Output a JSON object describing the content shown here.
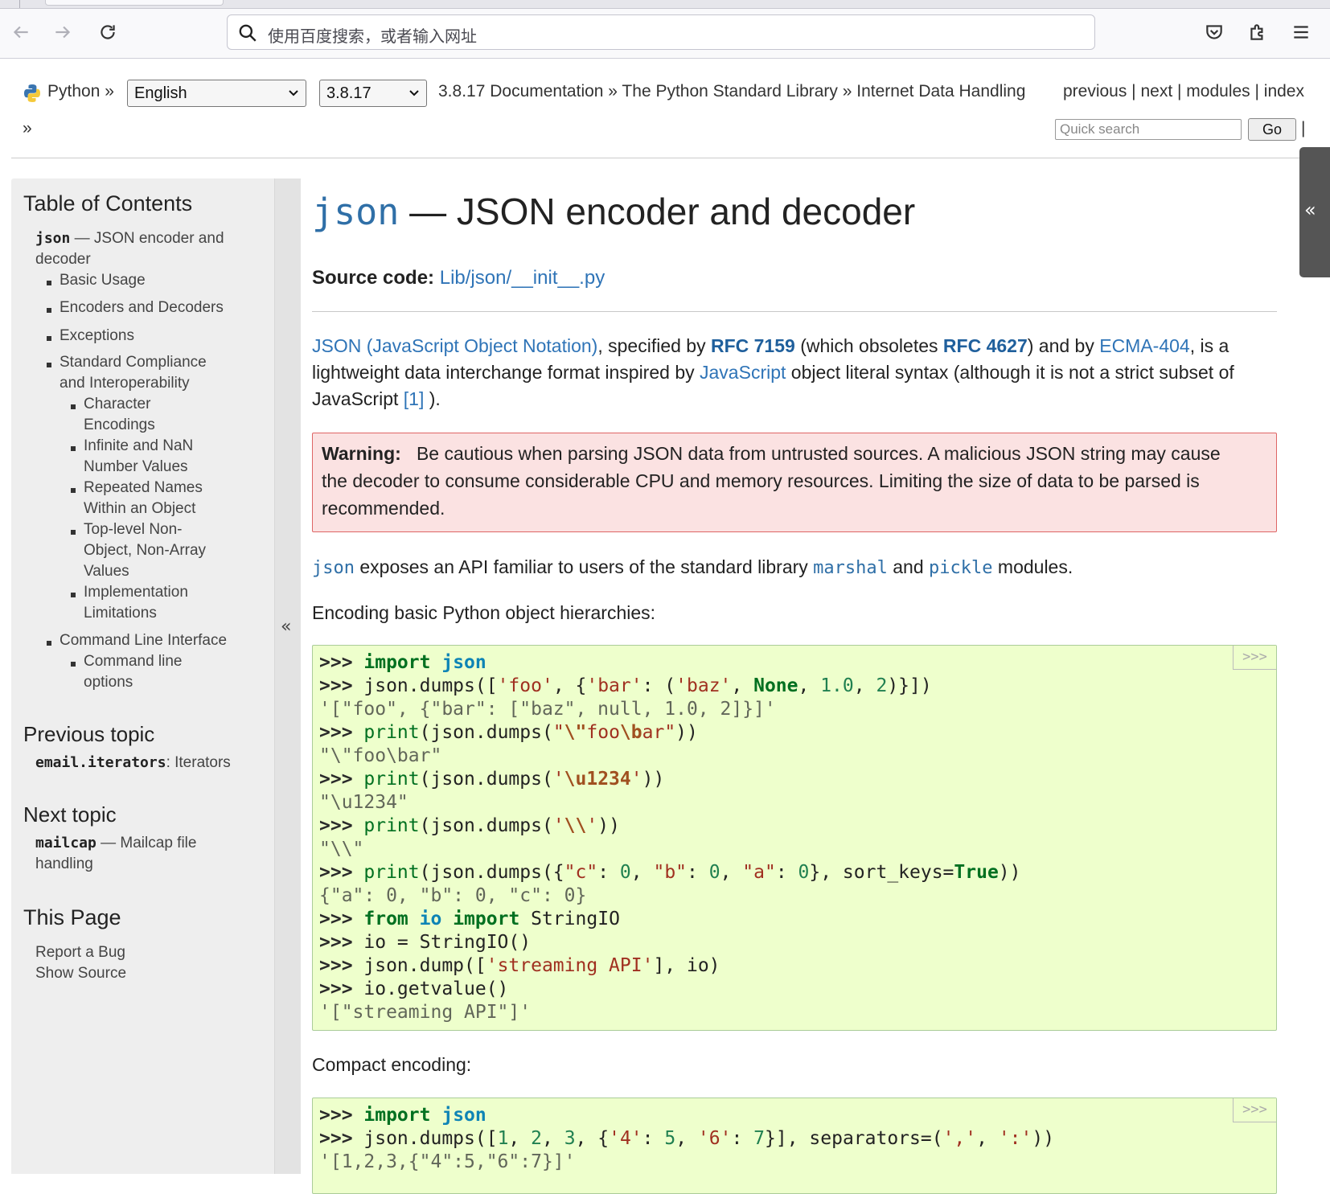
{
  "browser": {
    "url_placeholder": "使用百度搜索，或者输入网址"
  },
  "relbar": {
    "python": "Python »",
    "language": "English",
    "version": "3.8.17",
    "crumbs": "3.8.17 Documentation » The Python Standard Library » Internet Data Handling",
    "nav_links": "previous | next | modules | index",
    "raquo": "»",
    "search_placeholder": "Quick search",
    "go": "Go",
    "pipe": "|"
  },
  "sidebar": {
    "toc_title": "Table of Contents",
    "toc_root_code": "json",
    "toc_root_rest": " — JSON encoder and",
    "toc_root_rest2": "decoder",
    "toc_items": [
      "Basic Usage",
      "Encoders and Decoders",
      "Exceptions",
      "Standard Compliance",
      "and Interoperability",
      "Character",
      "Encodings",
      "Infinite and NaN",
      "Number Values",
      "Repeated Names",
      "Within an Object",
      "Top-level Non-",
      "Object, Non-Array",
      "Values",
      "Implementation",
      "Limitations",
      "Command Line Interface",
      "Command line",
      "options"
    ],
    "prev_title": "Previous topic",
    "prev_code": "email.iterators",
    "prev_rest": ": Iterators",
    "next_title": "Next topic",
    "next_code": "mailcap",
    "next_rest": " — Mailcap file",
    "next_rest2": "handling",
    "page_title": "This Page",
    "report_bug": "Report a Bug",
    "show_source": "Show Source",
    "collapse": "«"
  },
  "right_tab": "«",
  "main": {
    "title_code": "json",
    "title_rest": " — JSON encoder and decoder",
    "source_label": "Source code:",
    "source_link": "Lib/json/__init__.py",
    "intro": {
      "l1_a": "JSON (JavaScript Object Notation)",
      "l1_b": ", specified by ",
      "l1_c": "RFC 7159",
      "l1_d": " (which obsoletes ",
      "l1_e": "RFC 4627",
      "l1_f": ") and by ",
      "l1_g": "ECMA-404",
      "l1_h": ", is a",
      "l2_a": "lightweight data interchange format inspired by ",
      "l2_b": "JavaScript",
      "l2_c": " object literal syntax (although it is not a strict subset of",
      "l3_a": "JavaScript ",
      "l3_b": "[1]",
      "l3_c": " )."
    },
    "warning": {
      "label": "Warning:",
      "l1": "Be cautious when parsing JSON data from untrusted sources. A malicious JSON string may cause",
      "l2": "the decoder to consume considerable CPU and memory resources. Limiting the size of data to be parsed is",
      "l3": "recommended."
    },
    "api": {
      "json": "json",
      "a": " exposes an API familiar to users of the standard library ",
      "marshal": "marshal",
      "b": " and ",
      "pickle": "pickle",
      "c": " modules."
    },
    "encoding_label": "Encoding basic Python object hierarchies:",
    "compact_label": "Compact encoding:",
    "copy_label": ">>>"
  }
}
